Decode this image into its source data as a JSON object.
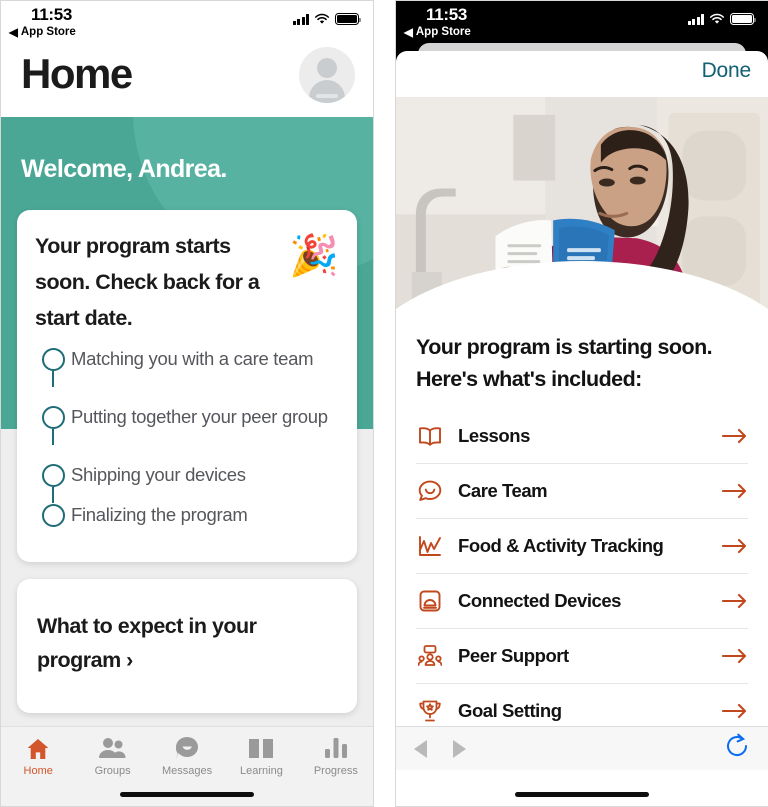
{
  "left_phone": {
    "status_bar": {
      "time": "11:53",
      "back_link": "App Store",
      "back_arrow": "◀"
    },
    "header": {
      "title": "Home",
      "avatar_name": "profile-avatar"
    },
    "banner": {
      "welcome": "Welcome, Andrea."
    },
    "program_card": {
      "heading": "Your program starts soon. Check back for a start date.",
      "emoji": "🎉",
      "steps": [
        {
          "label": "Matching you with a care team"
        },
        {
          "label": "Putting together your peer group"
        },
        {
          "label": "Shipping your devices"
        },
        {
          "label": "Finalizing the program"
        }
      ]
    },
    "expect_card": {
      "text": "What to expect in your program ›"
    },
    "tabbar": [
      {
        "label": "Home",
        "icon": "home-icon",
        "active": true
      },
      {
        "label": "Groups",
        "icon": "groups-icon",
        "active": false
      },
      {
        "label": "Messages",
        "icon": "messages-icon",
        "active": false
      },
      {
        "label": "Learning",
        "icon": "learning-icon",
        "active": false
      },
      {
        "label": "Progress",
        "icon": "progress-icon",
        "active": false
      }
    ]
  },
  "right_phone": {
    "status_bar": {
      "time": "11:53",
      "back_link": "App Store",
      "back_arrow": "◀"
    },
    "sheet_nav": {
      "done_label": "Done"
    },
    "hero": {
      "alt": "woman reading a blue health booklet in a kitchen"
    },
    "sheet": {
      "heading": "Your program is starting soon. Here's what's included:",
      "features": [
        {
          "label": "Lessons",
          "icon": "book-icon"
        },
        {
          "label": "Care Team",
          "icon": "chat-smile-icon"
        },
        {
          "label": "Food & Activity Tracking",
          "icon": "chart-line-icon"
        },
        {
          "label": "Connected Devices",
          "icon": "device-icon"
        },
        {
          "label": "Peer Support",
          "icon": "peer-group-icon"
        },
        {
          "label": "Goal Setting",
          "icon": "trophy-icon"
        }
      ]
    },
    "web_toolbar": {
      "back_icon": "back-triangle-icon",
      "forward_icon": "forward-triangle-icon",
      "reload_icon": "reload-icon"
    }
  },
  "colors": {
    "teal": "#4aa796",
    "teal_light": "#58b2a1",
    "teal_dark": "#1d6c77",
    "done_teal": "#126073",
    "orange": "#c1471d",
    "tab_orange": "#d2552c",
    "reload_blue": "#0a6cf0"
  }
}
